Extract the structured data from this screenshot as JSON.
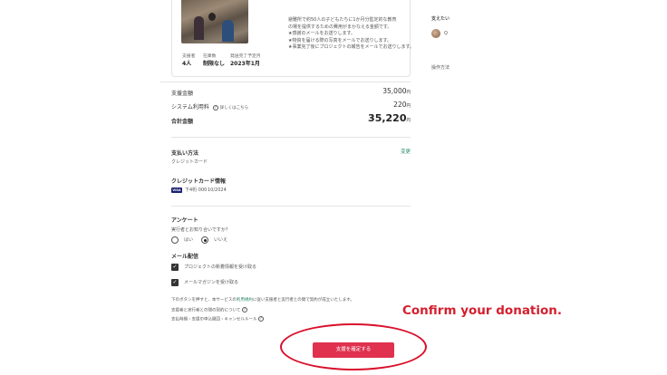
{
  "project_card": {
    "description_lines": [
      "避難所で約50人の子どもたちに1か月分監定的な教育",
      "の場を提供するための費用がまかなえる金額です。",
      "★感謝のメールをお送りします。",
      "★物資を届ける際の写真をメールでお送りします。",
      "★事業完了後にプロジェクトの報告をメールでお送りします。"
    ],
    "stats": [
      {
        "label": "支援者",
        "value": "4人"
      },
      {
        "label": "在庫数",
        "value": "制限なし"
      },
      {
        "label": "発送完了予定月",
        "value": "2023年1月"
      }
    ]
  },
  "sidebar": {
    "heading": "支えたい",
    "user_initial": "Q",
    "method_label": "操作方法"
  },
  "pricing": {
    "support_amount_label": "支援金額",
    "support_amount_value": "35,000",
    "system_fee_label": "システム利用料",
    "system_fee_link": "詳しくはこちら",
    "system_fee_value": "220",
    "total_label": "合計金額",
    "total_value": "35,220",
    "yen": "円"
  },
  "payment": {
    "heading": "支払い方法",
    "change_link": "変更",
    "method": "クレジットカード",
    "card_heading": "クレジットカード情報",
    "card_brand": "VISA",
    "card_number": "下4桁 000",
    "card_expiry": "10/2024"
  },
  "survey": {
    "heading": "アンケート",
    "question": "実行者とお知り合いですか？",
    "options": [
      "はい",
      "いいえ"
    ],
    "selected": "いいえ"
  },
  "mail": {
    "heading": "メール配信",
    "options": [
      "プロジェクトの新着情報を受け取る",
      "メールマガジンを受け取る"
    ]
  },
  "terms": {
    "line1_before": "下のボタンを押すと、本サービスの",
    "line1_link": "利用規約",
    "line1_after": "に従い支援者と実行者との間で契約が成立いたします。",
    "line2": "支援者と実行者との間の契約について",
    "line3": "支払時期・支援の申込撤回・キャンセルルール"
  },
  "confirm_button_label": "支援を確定する",
  "annotation_text": "Confirm your donation."
}
